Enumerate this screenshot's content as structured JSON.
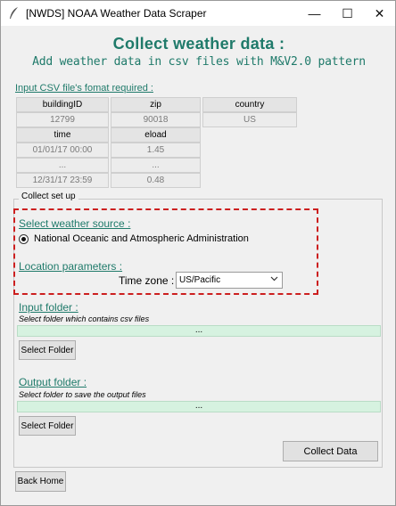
{
  "window": {
    "title": "[NWDS] NOAA Weather Data Scraper",
    "minimize_glyph": "—",
    "maximize_glyph": "☐",
    "close_glyph": "✕"
  },
  "header": {
    "title": "Collect weather data :",
    "subtitle": "Add weather data in csv files with M&V2.0 pattern"
  },
  "csv_format": {
    "label": "Input CSV file's fomat required :",
    "table": {
      "row1_headers": [
        "buildingID",
        "zip",
        "country"
      ],
      "row1_values": [
        "12799",
        "90018",
        "US"
      ],
      "row2_headers": [
        "time",
        "eload"
      ],
      "row2_values": [
        [
          "01/01/17 00:00",
          "1.45"
        ],
        [
          "...",
          "..."
        ],
        [
          "12/31/17 23:59",
          "0.48"
        ]
      ]
    }
  },
  "collect_setup": {
    "group_title": "Collect set up",
    "weather_source_label": "Select weather source :",
    "weather_source_option": "National Oceanic and Atmospheric Administration",
    "location_label": "Location parameters :",
    "time_zone_label": "Time zone :",
    "time_zone_value": "US/Pacific",
    "input_folder_label": "Input folder :",
    "input_folder_hint": "Select folder which contains csv files",
    "input_folder_path": "...",
    "input_select_button": "Select Folder",
    "output_folder_label": "Output folder :",
    "output_folder_hint": "Select folder to save the output files",
    "output_folder_path": "...",
    "output_select_button": "Select Folder",
    "collect_button": "Collect Data"
  },
  "footer": {
    "back_button": "Back Home"
  },
  "colors": {
    "accent": "#1f7a6a",
    "highlight_dash": "#cc1f1f",
    "path_bar": "#d6f2e0"
  }
}
